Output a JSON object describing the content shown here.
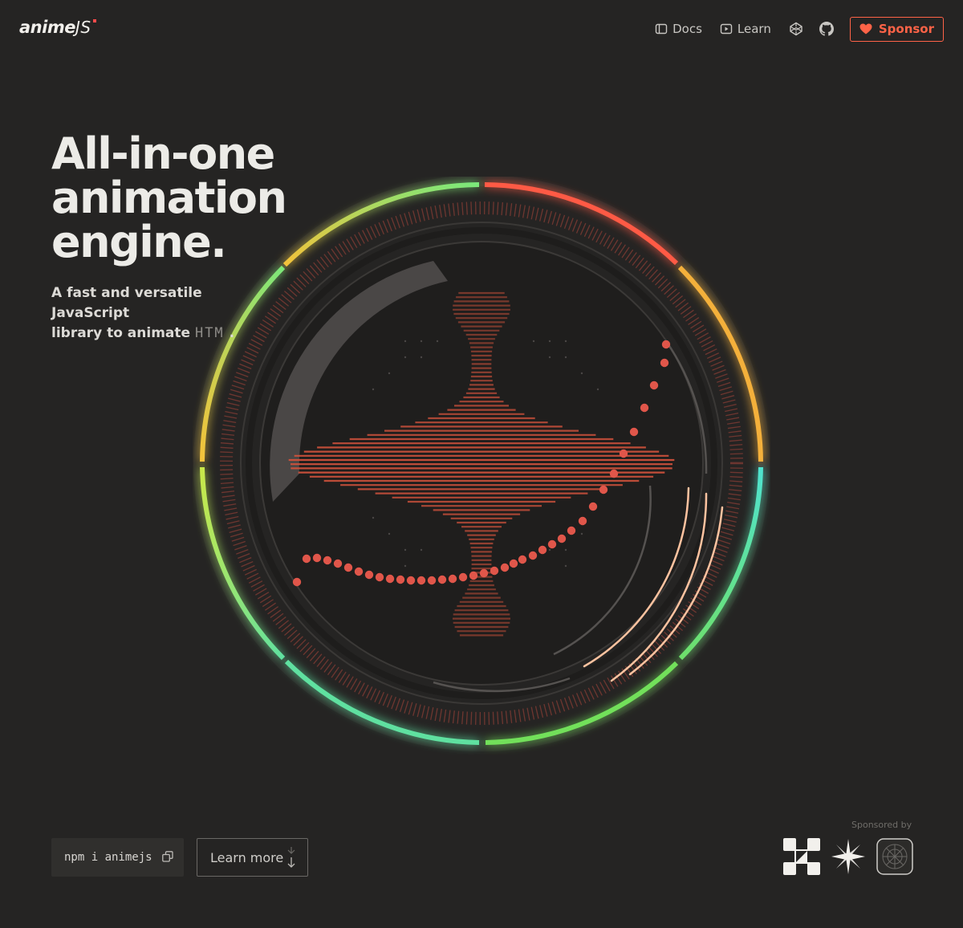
{
  "brand": {
    "name": "anime",
    "suffix": "JS",
    "accent": "#ff4b4b"
  },
  "nav": {
    "docs_label": "Docs",
    "learn_label": "Learn",
    "codepen_icon": "codepen-icon",
    "github_icon": "github-icon",
    "sponsor_label": "Sponsor"
  },
  "hero": {
    "title_lines": [
      "All-in-one",
      "animation",
      "engine."
    ],
    "subtitle_line1": "A fast and versatile JavaScript",
    "subtitle_line2_prefix": "library to animate ",
    "subtitle_tech": "HTM",
    "subtitle_suffix": " ."
  },
  "install": {
    "command": "npm i animejs",
    "copy_icon": "copy-icon"
  },
  "learn_more": {
    "label": "Learn more",
    "icon": "arrow-down-icon"
  },
  "sponsors": {
    "label": "Sponsored by",
    "logos": [
      "puzzle-logo",
      "star-logo",
      "grid-circle-logo"
    ]
  },
  "colors": {
    "background": "#252423",
    "accent_red": "#ff6347",
    "ring_green": "#5fe08a",
    "ring_orange": "#f0a23a",
    "ring_cyan": "#4fe3c8",
    "ring_yellow": "#f4c23a",
    "peach": "#ffc3a0"
  }
}
